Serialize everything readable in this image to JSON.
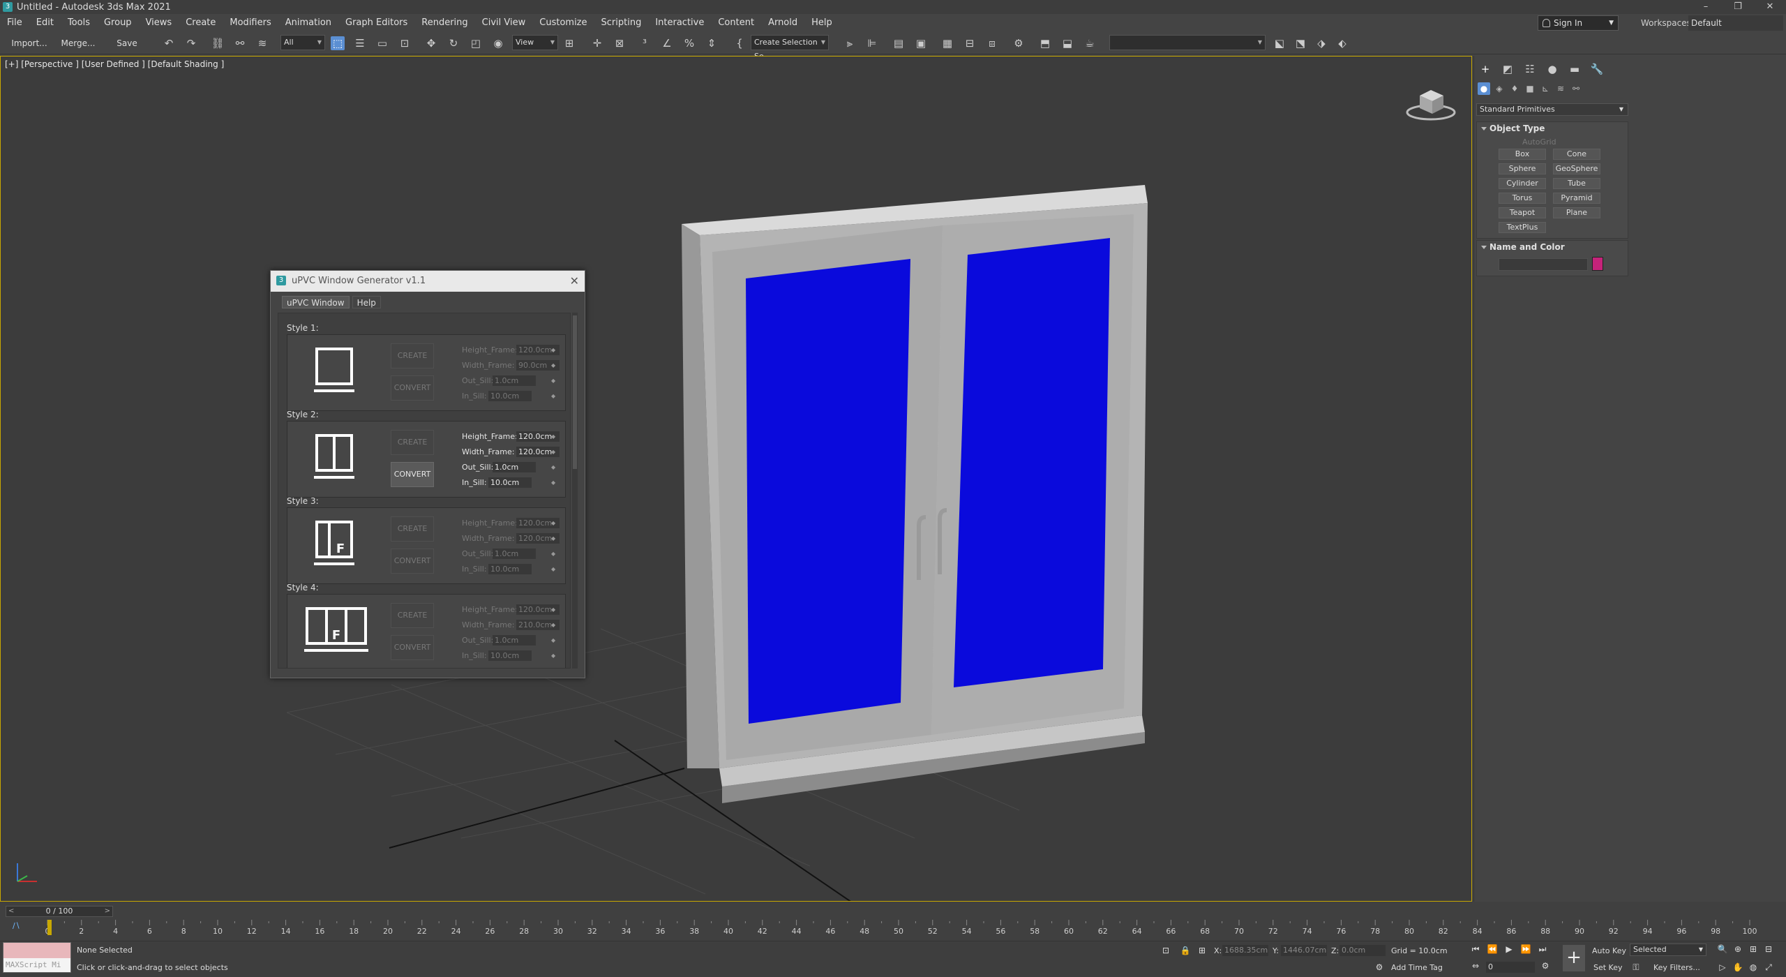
{
  "window": {
    "title": "Untitled - Autodesk 3ds Max 2021",
    "app_icon": "3",
    "minimize": "–",
    "restore": "❐",
    "close": "✕"
  },
  "menu": [
    "File",
    "Edit",
    "Tools",
    "Group",
    "Views",
    "Create",
    "Modifiers",
    "Animation",
    "Graph Editors",
    "Rendering",
    "Civil View",
    "Customize",
    "Scripting",
    "Interactive",
    "Content",
    "Arnold",
    "Help"
  ],
  "account": {
    "sign_in": "Sign In",
    "workspaces_label": "Workspaces:",
    "workspace": "Default"
  },
  "toolbar": {
    "import": "Import...",
    "merge": "Merge...",
    "save": "Save",
    "filter": "All",
    "ref_coord": "View",
    "selection_set": "Create Selection Se"
  },
  "viewport": {
    "label": "[+] [Perspective ] [User Defined ] [Default Shading ]",
    "glass_color": "#0a0adc",
    "frame_color": "#b4b4b4"
  },
  "dialog": {
    "icon": "3",
    "title": "uPVC Window Generator v1.1",
    "close": "✕",
    "tabs": [
      "uPVC Window",
      "Help"
    ],
    "create_label": "CREATE",
    "convert_label": "CONVERT",
    "styles": [
      {
        "label": "Style 1:",
        "height_frame": "120.0cm",
        "width_frame": "90.0cm",
        "out_sill": "1.0cm",
        "in_sill": "10.0cm"
      },
      {
        "label": "Style 2:",
        "height_frame": "120.0cm",
        "width_frame": "120.0cm",
        "out_sill": "1.0cm",
        "in_sill": "10.0cm"
      },
      {
        "label": "Style 3:",
        "height_frame": "120.0cm",
        "width_frame": "120.0cm",
        "out_sill": "1.0cm",
        "in_sill": "10.0cm",
        "icon_letter": "F"
      },
      {
        "label": "Style 4:",
        "height_frame": "120.0cm",
        "width_frame": "210.0cm",
        "out_sill": "1.0cm",
        "in_sill": "10.0cm",
        "icon_letter": "F"
      }
    ],
    "param_labels": {
      "height_frame": "Height_Frame:",
      "width_frame": "Width_Frame:",
      "out_sill": "Out_Sill:",
      "in_sill": "In_Sill:"
    }
  },
  "command_panel": {
    "category": "Standard Primitives",
    "object_type_title": "Object Type",
    "autogrid": "AutoGrid",
    "primitives": [
      "Box",
      "Cone",
      "Sphere",
      "GeoSphere",
      "Cylinder",
      "Tube",
      "Torus",
      "Pyramid",
      "Teapot",
      "Plane",
      "TextPlus"
    ],
    "name_color_title": "Name and Color",
    "object_color": "#c6237a"
  },
  "timeline": {
    "frame": "0 / 100",
    "prev": "<",
    "next": ">",
    "ticks": [
      "0",
      "2",
      "4",
      "6",
      "8",
      "10",
      "12",
      "14",
      "16",
      "18",
      "20",
      "22",
      "24",
      "26",
      "28",
      "30",
      "32",
      "34",
      "36",
      "38",
      "40",
      "42",
      "44",
      "46",
      "48",
      "50",
      "52",
      "54",
      "56",
      "58",
      "60",
      "62",
      "64",
      "66",
      "68",
      "70",
      "72",
      "74",
      "76",
      "78",
      "80",
      "82",
      "84",
      "86",
      "88",
      "90",
      "92",
      "94",
      "96",
      "98",
      "100"
    ]
  },
  "status": {
    "maxscript": "MAXScript Mi",
    "selection": "None Selected",
    "prompt": "Click or click-and-drag to select objects",
    "x_label": "X:",
    "x": "1688.35cm",
    "y_label": "Y:",
    "y": "1446.07cm",
    "z_label": "Z:",
    "z": "0.0cm",
    "grid": "Grid = 10.0cm",
    "add_time_tag": "Add Time Tag",
    "auto_key": "Auto Key",
    "set_key": "Set Key",
    "key_mode": "Selected",
    "key_filters": "Key Filters...",
    "current_frame": "0"
  }
}
